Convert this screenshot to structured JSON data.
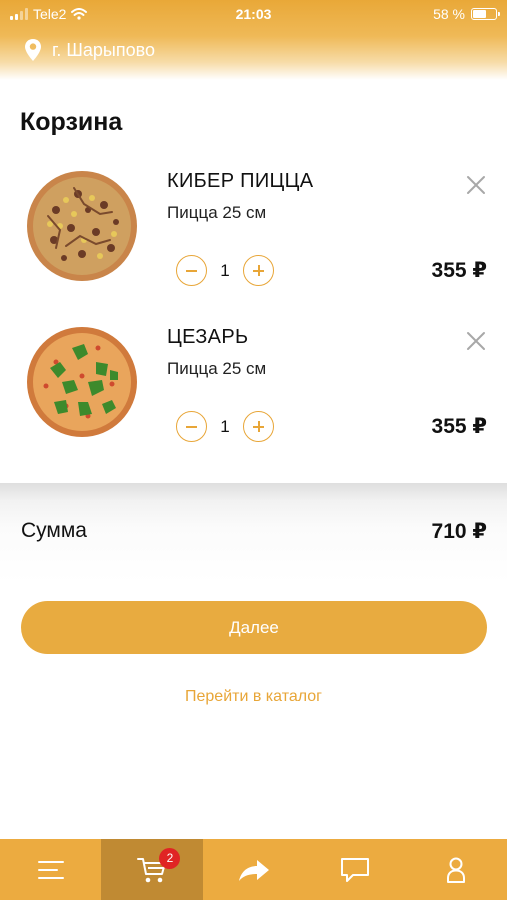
{
  "status_bar": {
    "carrier": "Tele2",
    "time": "21:03",
    "battery": "58 %",
    "battery_level": 0.58
  },
  "header": {
    "location_icon": "location-pin-icon",
    "city": "г. Шарыпово"
  },
  "page_title": "Корзина",
  "cart": {
    "items": [
      {
        "name": "КИБЕР ПИЦЦА",
        "size": "Пицца 25 см",
        "quantity": "1",
        "price": "355 ₽",
        "image": "pizza-cyber-image"
      },
      {
        "name": "ЦЕЗАРЬ",
        "size": "Пицца 25 см",
        "quantity": "1",
        "price": "355 ₽",
        "image": "pizza-caesar-image"
      }
    ]
  },
  "summary": {
    "label": "Сумма",
    "value": "710 ₽"
  },
  "actions": {
    "next_label": "Далее",
    "catalog_link": "Перейти в каталог"
  },
  "tabbar": {
    "tabs": [
      {
        "icon": "menu-icon",
        "active": false
      },
      {
        "icon": "cart-icon",
        "active": true,
        "badge": "2"
      },
      {
        "icon": "share-icon",
        "active": false
      },
      {
        "icon": "chat-icon",
        "active": false
      },
      {
        "icon": "profile-icon",
        "active": false
      }
    ]
  },
  "colors": {
    "accent": "#E8A638",
    "tabbar": "#ECAB40",
    "tab_active": "#C08A33",
    "badge": "#E02424"
  }
}
